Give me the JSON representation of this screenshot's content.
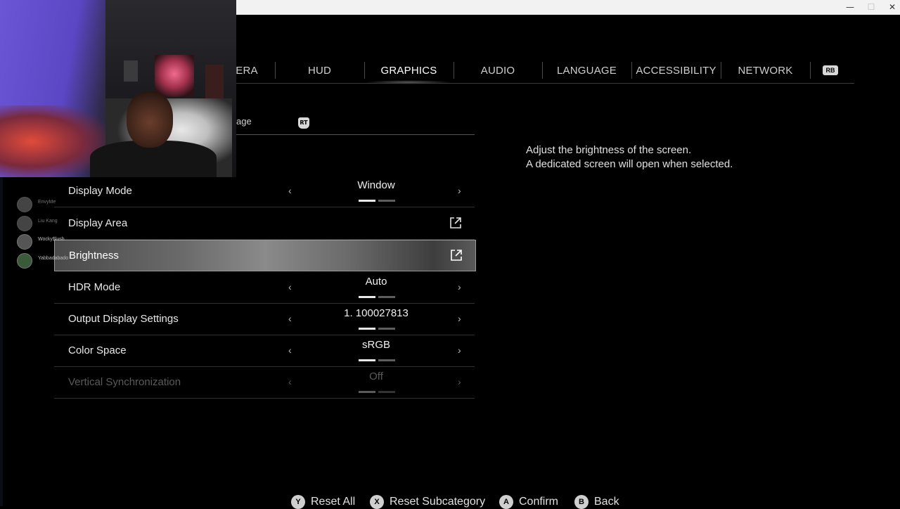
{
  "tabs": [
    {
      "label": "ERA",
      "active": false
    },
    {
      "label": "HUD",
      "active": false
    },
    {
      "label": "GRAPHICS",
      "active": true
    },
    {
      "label": "AUDIO",
      "active": false
    },
    {
      "label": "LANGUAGE",
      "active": false
    },
    {
      "label": "ACCESSIBILITY",
      "active": false
    },
    {
      "label": "NETWORK",
      "active": false
    }
  ],
  "tab_next_button": "RB",
  "subcategory": {
    "label": "age",
    "next_button": "RT"
  },
  "window_controls": {
    "minimize": "—",
    "maximize": "☐",
    "close": "✕"
  },
  "settings": [
    {
      "label": "Display Mode",
      "value": "Window",
      "type": "selector",
      "level": 1
    },
    {
      "label": "Display Area",
      "type": "link",
      "icon": "external-link-icon"
    },
    {
      "label": "Brightness",
      "type": "link",
      "icon": "external-link-icon",
      "selected": true
    },
    {
      "label": "HDR Mode",
      "value": "Auto",
      "type": "selector",
      "level": 1
    },
    {
      "label": "Output Display Settings",
      "value": "1. 100027813",
      "type": "selector",
      "level": 1
    },
    {
      "label": "Color Space",
      "value": "sRGB",
      "type": "selector",
      "level": 1
    },
    {
      "label": "Vertical Synchronization",
      "value": "Off",
      "type": "selector",
      "level": 1,
      "disabled": true
    }
  ],
  "arrows": {
    "left": "‹",
    "right": "›"
  },
  "description": {
    "line1": "Adjust the brightness of the screen.",
    "line2": "A dedicated screen will open when selected."
  },
  "footer": [
    {
      "button": "Y",
      "label": "Reset All"
    },
    {
      "button": "X",
      "label": "Reset Subcategory"
    },
    {
      "button": "A",
      "label": "Confirm"
    },
    {
      "button": "B",
      "label": "Back"
    }
  ],
  "party": [
    {
      "name": "EnvyMe",
      "dim": true
    },
    {
      "name": "Liu Kang",
      "dim": true
    },
    {
      "name": "Wocky$lush",
      "dim": false
    },
    {
      "name": "Yabbadabado",
      "dim": false
    }
  ]
}
